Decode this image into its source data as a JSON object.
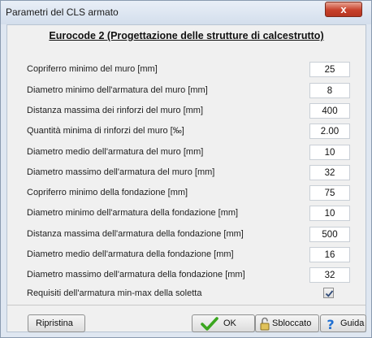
{
  "window": {
    "title": "Parametri del CLS armato",
    "close_glyph": "x"
  },
  "heading": "Eurocode 2 (Progettazione delle strutture di calcestrutto)",
  "rows": [
    {
      "label": "Copriferro minimo del muro [mm]",
      "value": "25"
    },
    {
      "label": "Diametro minimo dell'armatura del muro [mm]",
      "value": "8"
    },
    {
      "label": "Distanza massima dei rinforzi del muro [mm]",
      "value": "400"
    },
    {
      "label": "Quantità minima di rinforzi del muro [‰]",
      "value": "2.00"
    },
    {
      "label": "Diametro medio dell'armatura del muro [mm]",
      "value": "10"
    },
    {
      "label": "Diametro massimo dell'armatura del muro [mm]",
      "value": "32"
    },
    {
      "label": "Copriferro minimo della fondazione [mm]",
      "value": "75"
    },
    {
      "label": "Diametro minimo dell'armatura della fondazione [mm]",
      "value": "10"
    },
    {
      "label": "Distanza massima dell'armatura della fondazione [mm]",
      "value": "500"
    },
    {
      "label": "Diametro medio dell'armatura della fondazione [mm]",
      "value": "16"
    },
    {
      "label": "Diametro massimo dell'armatura della fondazione [mm]",
      "value": "32"
    }
  ],
  "checkbox_row": {
    "label": "Requisiti dell'armatura min-max della soletta",
    "checked": true
  },
  "buttons": {
    "reset": "Ripristina",
    "ok": "OK",
    "unlock": "Sbloccato",
    "help": "Guida"
  },
  "icons": {
    "close": "close-icon",
    "checkmark": "checkmark-icon",
    "ok": "green-check-icon",
    "unlock": "unlock-icon",
    "help": "question-mark-icon"
  },
  "colors": {
    "close_button": "#c7412b",
    "ok_check": "#3aa61f",
    "help_icon": "#1f6fd1"
  }
}
